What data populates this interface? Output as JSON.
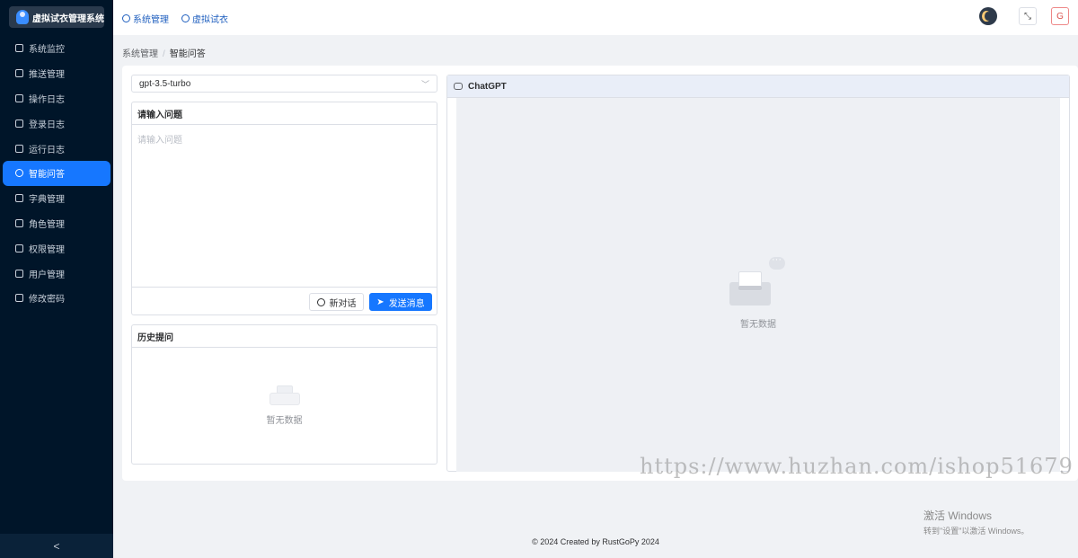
{
  "app": {
    "title": "虚拟试衣管理系统"
  },
  "sidebar": {
    "items": [
      {
        "label": "系统监控",
        "icon": "monitor-icon"
      },
      {
        "label": "推送管理",
        "icon": "document-icon"
      },
      {
        "label": "操作日志",
        "icon": "file-icon"
      },
      {
        "label": "登录日志",
        "icon": "log-icon"
      },
      {
        "label": "运行日志",
        "icon": "list-icon"
      },
      {
        "label": "智能问答",
        "icon": "chat-icon",
        "active": true
      },
      {
        "label": "字典管理",
        "icon": "grid-icon"
      },
      {
        "label": "角色管理",
        "icon": "users-icon"
      },
      {
        "label": "权限管理",
        "icon": "link-icon"
      },
      {
        "label": "用户管理",
        "icon": "user-icon"
      },
      {
        "label": "修改密码",
        "icon": "lock-icon"
      }
    ],
    "collapse_icon": "<"
  },
  "header": {
    "nav": [
      {
        "label": "系统管理",
        "icon": "gear-icon"
      },
      {
        "label": "虚拟试衣",
        "icon": "chat-icon"
      }
    ],
    "fullscreen_glyph": "⤡",
    "logout_glyph": "G"
  },
  "breadcrumb": {
    "parent": "系统管理",
    "separator": "/",
    "current": "智能问答"
  },
  "model_select": {
    "value": "gpt-3.5-turbo",
    "caret": "﹀"
  },
  "question": {
    "title": "请输入问题",
    "placeholder": "请输入问题",
    "new_chat_label": "新对话",
    "send_label": "发送消息",
    "send_glyph": "➤"
  },
  "history": {
    "title": "历史提问",
    "empty_text": "暂无数据"
  },
  "chat": {
    "title": "ChatGPT",
    "empty_text": "暂无数据"
  },
  "footer": {
    "text": "© 2024 Created by RustGoPy 2024"
  },
  "watermark": {
    "text": "https://www.huzhan.com/ishop51679"
  },
  "windows_activation": {
    "line1": "激活 Windows",
    "line2": "转到\"设置\"以激活 Windows。"
  },
  "colors": {
    "sidebar_bg": "#001529",
    "accent": "#1677ff",
    "chat_header_bg": "#e9eef8"
  }
}
